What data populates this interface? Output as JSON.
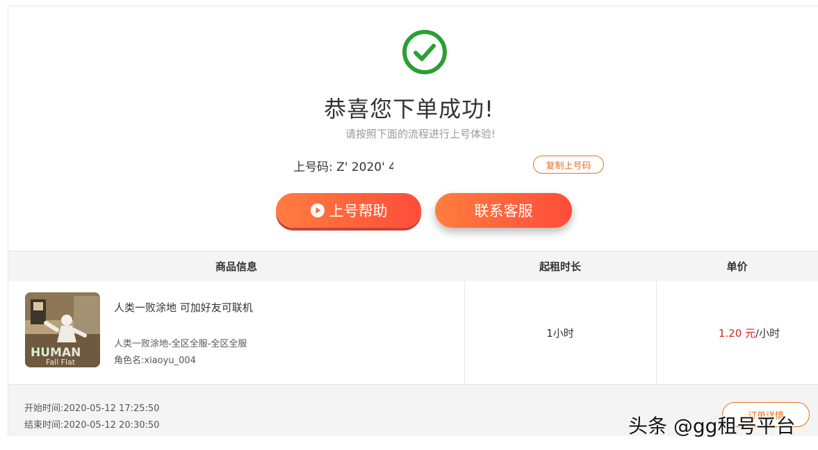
{
  "success": {
    "title": "恭喜您下单成功!",
    "subtitle": "请按照下面的流程进行上号体验!",
    "code_label": "上号码:",
    "code_value": "Z' 2020' 4",
    "copy_button": "复制上号码",
    "help_button": "上号帮助",
    "service_button": "联系客服"
  },
  "table": {
    "headers": [
      "商品信息",
      "起租时长",
      "单价"
    ],
    "row": {
      "product_name": "人类一败涂地 可加好友可联机",
      "server": "人类一败涂地-全区全服-全区全服",
      "role": "角色名:xiaoyu_004",
      "thumbnail_text": [
        "HUMAN",
        "Fall Flat"
      ],
      "duration": "1小时",
      "price_value": "1.20 元",
      "price_unit": "/小时"
    }
  },
  "footer": {
    "start_time": "开始时间:2020-05-12 17:25:50",
    "end_time": "结束时间:2020-05-12 20:30:50",
    "detail_button": "订单详情"
  },
  "watermark": "头条 @gg租号平台",
  "colors": {
    "success_green": "#2aa034",
    "accent_orange": "#e8711f",
    "button_gradient_start": "#ff7d3f",
    "button_gradient_end": "#ff4d3a",
    "price_red": "#e02020"
  },
  "icons": [
    "check-circle-icon",
    "play-circle-icon"
  ]
}
